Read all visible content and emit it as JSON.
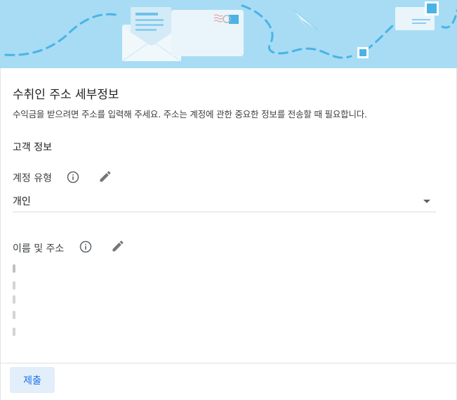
{
  "page": {
    "title": "수취인 주소 세부정보",
    "subtitle": "수익금을 받으려면 주소를 입력해 주세요. 주소는 계정에 관한 중요한 정보를 전송할 때 필요합니다."
  },
  "customer_info": {
    "section_label": "고객 정보",
    "account_type": {
      "label": "계정 유형",
      "selected_value": "개인"
    },
    "name_address": {
      "label": "이름 및 주소"
    }
  },
  "footer": {
    "submit_label": "제출"
  },
  "colors": {
    "banner_bg": "#a7dcf4",
    "accent": "#1a73e8",
    "button_bg": "#e3eefb"
  },
  "icons": [
    "envelope-illustration",
    "paper-plane-icon",
    "info-icon",
    "edit-icon",
    "chevron-down-icon"
  ]
}
